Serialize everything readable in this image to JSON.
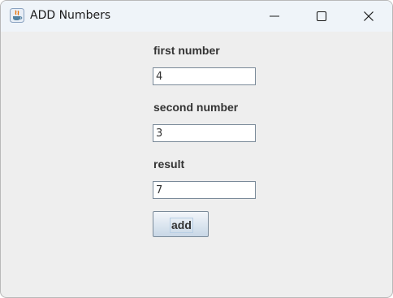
{
  "window": {
    "title": "ADD Numbers",
    "icon": "java-cup-icon",
    "controls": [
      "minimize-icon",
      "maximize-icon",
      "close-icon"
    ]
  },
  "form": {
    "first_label": "first number",
    "first_value": "4",
    "second_label": "second number",
    "second_value": "3",
    "result_label": "result",
    "result_value": "7",
    "add_label": "add"
  },
  "colors": {
    "titlebar": "#eff4f9",
    "panel": "#eeeeee",
    "field_border": "#7a8a99",
    "label_text": "#333333"
  }
}
